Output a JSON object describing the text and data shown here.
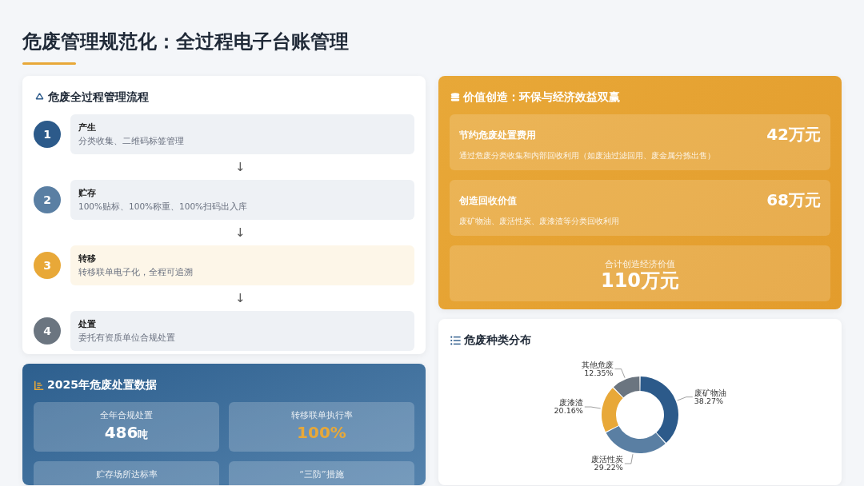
{
  "title": "危废管理规范化：全过程电子台账管理",
  "process": {
    "title": "危废全过程管理流程",
    "steps": [
      {
        "number": "1",
        "name": "产生",
        "desc": "分类收集、二维码标签管理",
        "color": "#2c5a8a",
        "highlighted": false
      },
      {
        "number": "2",
        "name": "贮存",
        "desc": "100%贴标、100%称重、100%扫码出入库",
        "color": "#5a7fa3",
        "highlighted": false
      },
      {
        "number": "3",
        "name": "转移",
        "desc": "转移联单电子化，全程可追溯",
        "color": "#e8a838",
        "highlighted": true
      },
      {
        "number": "4",
        "name": "处置",
        "desc": "委托有资质单位合规处置",
        "color": "#6b7580",
        "highlighted": false
      }
    ],
    "arrows": [
      "↓",
      "↓",
      "↓"
    ]
  },
  "stats": {
    "title": "2025年危废处置数据",
    "tiles": [
      {
        "label": "全年合规处置",
        "value": "486",
        "unit": "吨",
        "accent": false
      },
      {
        "label": "转移联单执行率",
        "value": "100%",
        "accent": true
      },
      {
        "label": "贮存场所达标率"
      },
      {
        "label": "“三防”措施"
      }
    ]
  },
  "value": {
    "title": "价值创造：环保与经济效益双赢",
    "items": [
      {
        "name": "节约危废处置费用",
        "amount": "42万元",
        "desc": "通过危废分类收集和内部回收利用（如废油过滤回用、废金属分拣出售）"
      },
      {
        "name": "创造回收价值",
        "amount": "68万元",
        "desc": "废矿物油、废活性炭、废漆渣等分类回收利用"
      }
    ],
    "total": {
      "label": "合计创造经济价值",
      "amount": "110万元"
    }
  },
  "distribution": {
    "title": "危废种类分布",
    "chart_data": {
      "type": "donut",
      "categories": [
        "废矿物油",
        "废活性炭",
        "废漆渣",
        "其他危废"
      ],
      "series": [
        {
          "values": [
            38.27,
            29.22,
            20.16,
            12.35
          ]
        }
      ],
      "colors": [
        "#2c5a8a",
        "#5a7fa3",
        "#e8a838",
        "#6b7580"
      ],
      "value_labels": [
        "38.27%",
        "29.22%",
        "20.16%",
        "12.35%"
      ]
    }
  }
}
